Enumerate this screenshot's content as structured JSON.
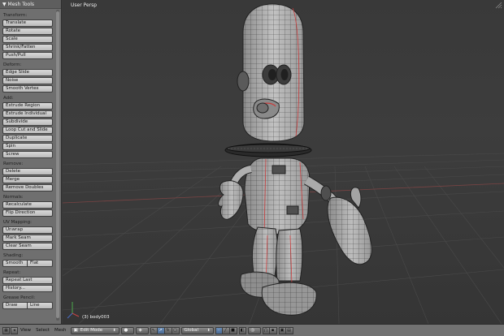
{
  "shelf": {
    "header": "▼ Mesh Tools",
    "sections": [
      {
        "title": "Transform:",
        "buttons": [
          "Translate",
          "Rotate",
          "Scale",
          "Shrink/Fatten",
          "Push/Pull"
        ]
      },
      {
        "title": "Deform:",
        "buttons": [
          "Edge Slide",
          "Noise",
          "Smooth Vertex"
        ]
      },
      {
        "title": "Add:",
        "buttons": [
          "Extrude Region",
          "Extrude Individual",
          "Subdivide",
          "Loop Cut and Slide",
          "Duplicate",
          "Spin",
          "Screw"
        ]
      },
      {
        "title": "Remove:",
        "buttons": [
          "Delete",
          "Merge",
          "Remove Doubles"
        ]
      },
      {
        "title": "Normals:",
        "buttons": [
          "Recalculate",
          "Flip Direction"
        ]
      },
      {
        "title": "UV Mapping:",
        "buttons": [
          "Unwrap",
          "Mark Seam",
          "Clear Seam"
        ]
      },
      {
        "title": "Shading:",
        "row": [
          "Smooth",
          "Flat"
        ]
      },
      {
        "title": "Repeat:",
        "buttons": [
          "Repeat Last",
          "History..."
        ]
      },
      {
        "title": "Grease Pencil:",
        "row": [
          "Draw",
          "Line"
        ]
      }
    ]
  },
  "viewport": {
    "title": "User Persp",
    "object_label": "(3) body003"
  },
  "bottombar": {
    "menus": [
      "View",
      "Select",
      "Mesh"
    ],
    "mode": "Edit Mode",
    "pivot": "Global"
  },
  "colors": {
    "shelf_bg": "#6f6f6f",
    "viewport_bg": "#393939",
    "mesh_face": "#a9a9a9",
    "mesh_wire": "#1e1e1e",
    "seam": "#c83c3c",
    "selected_blue": "#5b7fae"
  }
}
